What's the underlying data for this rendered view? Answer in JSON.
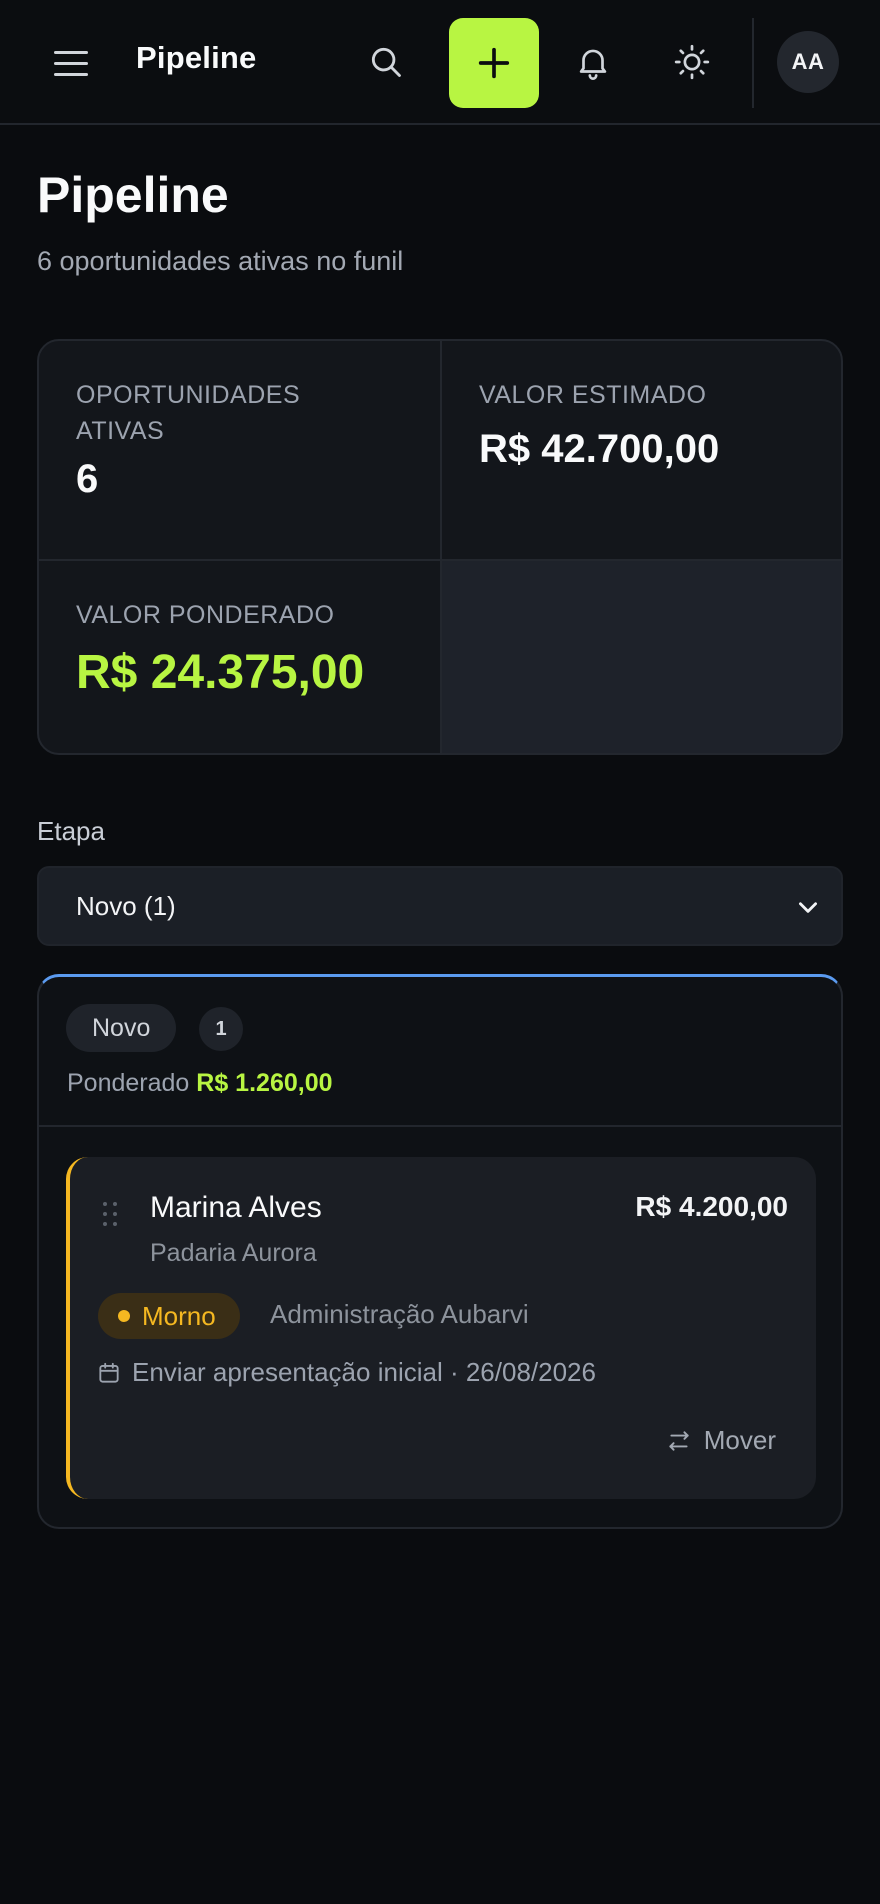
{
  "header": {
    "title": "Pipeline",
    "avatar_initials": "AA",
    "icons": [
      "menu-icon",
      "search-icon",
      "plus-icon",
      "bell-icon",
      "sun-icon"
    ],
    "accent_color": "#b8f542"
  },
  "page": {
    "title": "Pipeline",
    "subtitle": "6 oportunidades ativas no funil"
  },
  "stats": {
    "active_label": "OPORTUNIDADES ATIVAS",
    "active_value": "6",
    "estimated_label": "VALOR ESTIMADO",
    "estimated_value": "R$ 42.700,00",
    "weighted_label": "VALOR PONDERADO",
    "weighted_value": "R$ 24.375,00"
  },
  "stage_filter": {
    "label": "Etapa",
    "selected": "Novo (1)"
  },
  "column": {
    "stage_name": "Novo",
    "count": "1",
    "weighted_label": "Ponderado",
    "weighted_value": "R$ 1.260,00",
    "top_border_color": "#5b9bf0",
    "cards": [
      {
        "name": "Marina Alves",
        "company": "Padaria Aurora",
        "amount": "R$ 4.200,00",
        "temperature": "Morno",
        "temperature_color": "#f5b821",
        "owner": "Administração Aubarvi",
        "task": "Enviar apresentação inicial · 26/08/2026",
        "move_label": "Mover"
      }
    ]
  }
}
